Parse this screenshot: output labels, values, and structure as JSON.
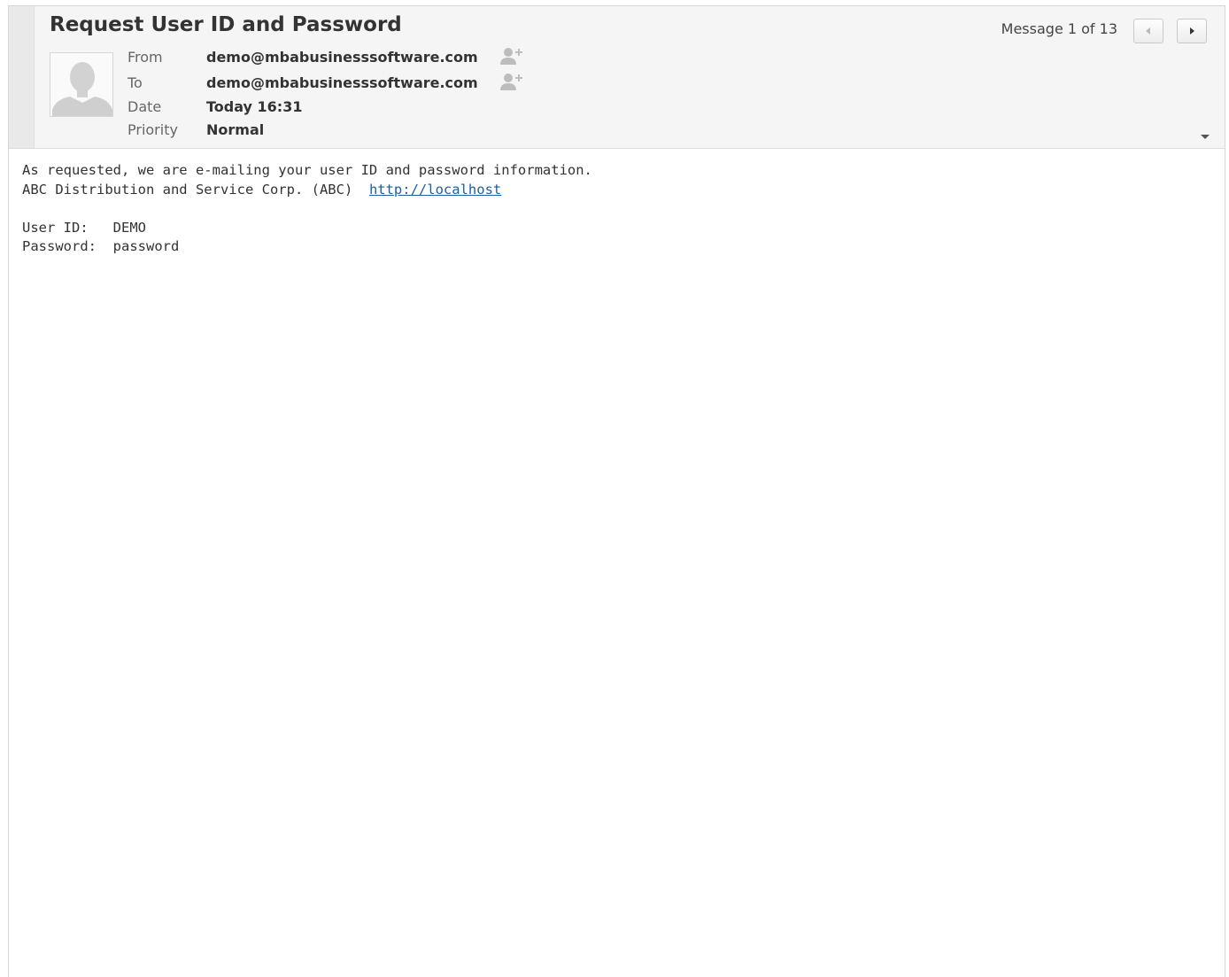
{
  "message": {
    "subject": "Request User ID and Password",
    "counter": "Message 1 of 13",
    "headers": [
      {
        "label": "From",
        "value": "demo@mbabusinesssoftware.com",
        "add_contact": true
      },
      {
        "label": "To",
        "value": "demo@mbabusinesssoftware.com",
        "add_contact": true
      },
      {
        "label": "Date",
        "value": "Today 16:31",
        "add_contact": false
      },
      {
        "label": "Priority",
        "value": "Normal",
        "add_contact": false
      }
    ],
    "body": {
      "line1": "As requested, we are e-mailing your user ID and password information.",
      "line2_text": "ABC Distribution and Service Corp. (ABC)  ",
      "line2_link": "http://localhost",
      "userid_label": "User ID:   ",
      "userid_value": "DEMO",
      "password_label": "Password:  ",
      "password_value": "password"
    }
  },
  "icons": {
    "avatar": "person-silhouette-icon",
    "add_contact": "add-contact-icon",
    "prev": "arrow-left-icon",
    "next": "arrow-right-icon",
    "toggle": "chevron-down-icon"
  },
  "colors": {
    "header_bg": "#f5f5f5",
    "link": "#1d5fa5",
    "text": "#333333",
    "label": "#666666"
  }
}
